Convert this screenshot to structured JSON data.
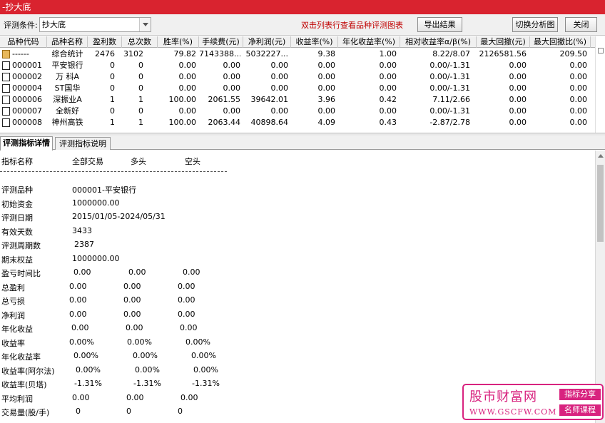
{
  "window": {
    "title": "-抄大底"
  },
  "toolbar": {
    "condition_label": "评测条件:",
    "condition_value": "抄大底",
    "hint": "双击列表行查看品种评测图表",
    "export_label": "导出结果",
    "switch_label": "切换分析图",
    "close_label": "关闭"
  },
  "table": {
    "headers": [
      "品种代码",
      "品种名称",
      "盈利数",
      "总次数",
      "胜率(%)",
      "手续费(元)",
      "净利润(元)",
      "收益率(%)",
      "年化收益率(%)",
      "相对收益率α/β(%)",
      "最大回撤(元)",
      "最大回撤比(%)"
    ],
    "rows": [
      [
        "------",
        "综合统计",
        "2476",
        "3102",
        "79.82",
        "7143388....",
        "5032227...",
        "9.38",
        "1.00",
        "8.22/8.07",
        "2126581.56",
        "209.50"
      ],
      [
        "000001",
        "平安银行",
        "0",
        "0",
        "0.00",
        "0.00",
        "0.00",
        "0.00",
        "0.00",
        "0.00/-1.31",
        "0.00",
        "0.00"
      ],
      [
        "000002",
        "万 科A",
        "0",
        "0",
        "0.00",
        "0.00",
        "0.00",
        "0.00",
        "0.00",
        "0.00/-1.31",
        "0.00",
        "0.00"
      ],
      [
        "000004",
        "ST国华",
        "0",
        "0",
        "0.00",
        "0.00",
        "0.00",
        "0.00",
        "0.00",
        "0.00/-1.31",
        "0.00",
        "0.00"
      ],
      [
        "000006",
        "深振业A",
        "1",
        "1",
        "100.00",
        "2061.55",
        "39642.01",
        "3.96",
        "0.42",
        "7.11/2.66",
        "0.00",
        "0.00"
      ],
      [
        "000007",
        "全新好",
        "0",
        "0",
        "0.00",
        "0.00",
        "0.00",
        "0.00",
        "0.00",
        "0.00/-1.31",
        "0.00",
        "0.00"
      ],
      [
        "000008",
        "神州高铁",
        "1",
        "1",
        "100.00",
        "2063.44",
        "40898.64",
        "4.09",
        "0.43",
        "-2.87/2.78",
        "0.00",
        "0.00"
      ]
    ]
  },
  "tabs": [
    "评测指标详情",
    "评测指标说明"
  ],
  "details": {
    "header": [
      "指标名称",
      "全部交易",
      "多头",
      "空头"
    ],
    "info": [
      {
        "label": "评测品种",
        "value": "000001-平安银行"
      },
      {
        "label": "初始资金",
        "value": "1000000.00"
      },
      {
        "label": "评测日期",
        "value": "2015/01/05-2024/05/31"
      },
      {
        "label": "有效天数",
        "value": "3433"
      },
      {
        "label": "评测周期数",
        "value": "2387"
      },
      {
        "label": "期末权益",
        "value": "1000000.00"
      }
    ],
    "metrics": [
      {
        "label": "盈亏时间比",
        "values": [
          "0.00",
          "0.00",
          "0.00"
        ]
      },
      {
        "label": "总盈利",
        "values": [
          "0.00",
          "0.00",
          "0.00"
        ]
      },
      {
        "label": "总亏损",
        "values": [
          "0.00",
          "0.00",
          "0.00"
        ]
      },
      {
        "label": "净利润",
        "values": [
          "0.00",
          "0.00",
          "0.00"
        ]
      },
      {
        "label": "年化收益",
        "values": [
          "0.00",
          "0.00",
          "0.00"
        ]
      },
      {
        "label": "收益率",
        "values": [
          "0.00%",
          "0.00%",
          "0.00%"
        ]
      },
      {
        "label": "年化收益率",
        "values": [
          "0.00%",
          "0.00%",
          "0.00%"
        ]
      },
      {
        "label": "收益率(阿尔法)",
        "values": [
          "0.00%",
          "0.00%",
          "0.00%"
        ]
      },
      {
        "label": "收益率(贝塔)",
        "values": [
          "-1.31%",
          "-1.31%",
          "-1.31%"
        ]
      },
      {
        "label": "平均利润",
        "values": [
          "0.00",
          "0.00",
          "0.00"
        ]
      },
      {
        "label": "交易量(股/手)",
        "values": [
          "0",
          "0",
          "0"
        ]
      }
    ]
  },
  "watermark": {
    "title": "股市财富网",
    "url": "WWW.GSCFW.COM",
    "tag1": "指标分享",
    "tag2": "名师课程",
    "color": "#d8237f"
  }
}
